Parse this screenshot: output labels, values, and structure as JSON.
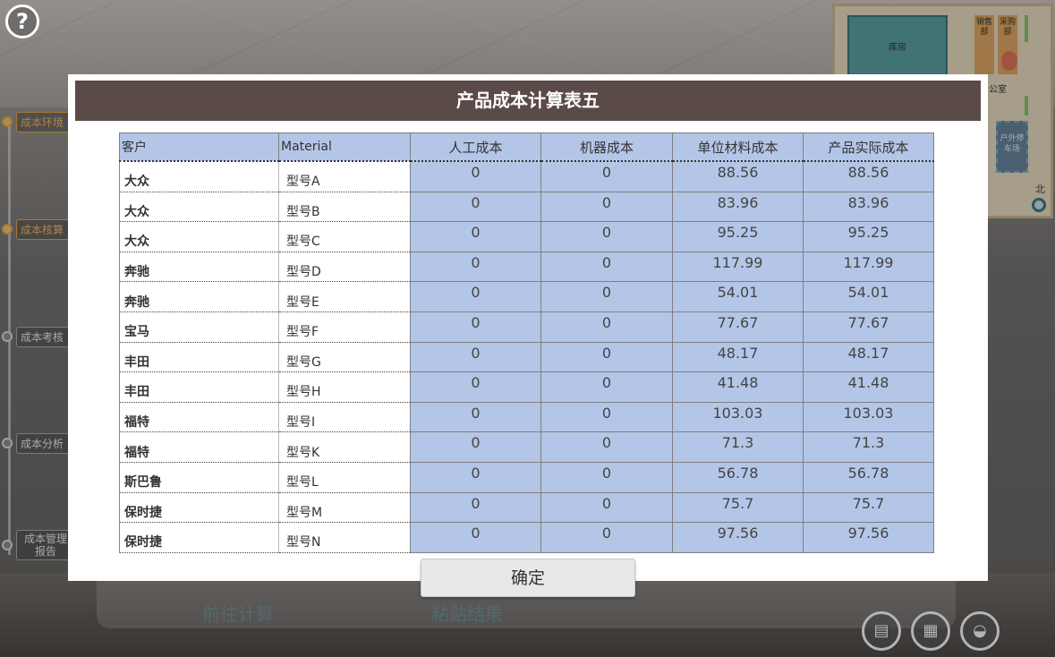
{
  "help": {
    "icon": "?"
  },
  "timeline": [
    {
      "label": "成本环境",
      "active": true
    },
    {
      "label": "成本核算",
      "active": true
    },
    {
      "label": "成本考核",
      "active": false
    },
    {
      "label": "成本分析",
      "active": false
    },
    {
      "label": "成本管理报告",
      "active": false
    }
  ],
  "minimap": {
    "warehouse": "库房",
    "sales": "销售部",
    "purchase": "采购部",
    "office": "公室",
    "parking": "户外停车场",
    "north": "北"
  },
  "dialog": {
    "title": "产品成本计算表五",
    "confirm_label": "确定",
    "headers": [
      "客户",
      "Material",
      "人工成本",
      "机器成本",
      "单位材料成本",
      "产品实际成本"
    ],
    "rows": [
      {
        "customer": "大众",
        "model": "型号A",
        "labor": "0",
        "machine": "0",
        "unit_material": "88.56",
        "actual": "88.56"
      },
      {
        "customer": "大众",
        "model": "型号B",
        "labor": "0",
        "machine": "0",
        "unit_material": "83.96",
        "actual": "83.96"
      },
      {
        "customer": "大众",
        "model": "型号C",
        "labor": "0",
        "machine": "0",
        "unit_material": "95.25",
        "actual": "95.25"
      },
      {
        "customer": "奔驰",
        "model": "型号D",
        "labor": "0",
        "machine": "0",
        "unit_material": "117.99",
        "actual": "117.99"
      },
      {
        "customer": "奔驰",
        "model": "型号E",
        "labor": "0",
        "machine": "0",
        "unit_material": "54.01",
        "actual": "54.01"
      },
      {
        "customer": "宝马",
        "model": "型号F",
        "labor": "0",
        "machine": "0",
        "unit_material": "77.67",
        "actual": "77.67"
      },
      {
        "customer": "丰田",
        "model": "型号G",
        "labor": "0",
        "machine": "0",
        "unit_material": "48.17",
        "actual": "48.17"
      },
      {
        "customer": "丰田",
        "model": "型号H",
        "labor": "0",
        "machine": "0",
        "unit_material": "41.48",
        "actual": "41.48"
      },
      {
        "customer": "福特",
        "model": "型号I",
        "labor": "0",
        "machine": "0",
        "unit_material": "103.03",
        "actual": "103.03"
      },
      {
        "customer": "福特",
        "model": "型号K",
        "labor": "0",
        "machine": "0",
        "unit_material": "71.3",
        "actual": "71.3"
      },
      {
        "customer": "斯巴鲁",
        "model": "型号L",
        "labor": "0",
        "machine": "0",
        "unit_material": "56.78",
        "actual": "56.78"
      },
      {
        "customer": "保时捷",
        "model": "型号M",
        "labor": "0",
        "machine": "0",
        "unit_material": "75.7",
        "actual": "75.7"
      },
      {
        "customer": "保时捷",
        "model": "型号N",
        "labor": "0",
        "machine": "0",
        "unit_material": "97.56",
        "actual": "97.56"
      }
    ]
  },
  "bottom": {
    "goto_label": "前往计算",
    "paste_label": "粘贴结果"
  },
  "colors": {
    "header_bg": "#5a4a48",
    "cell_blue": "#b4c6e7",
    "timeline_active": "#e8a53b"
  }
}
